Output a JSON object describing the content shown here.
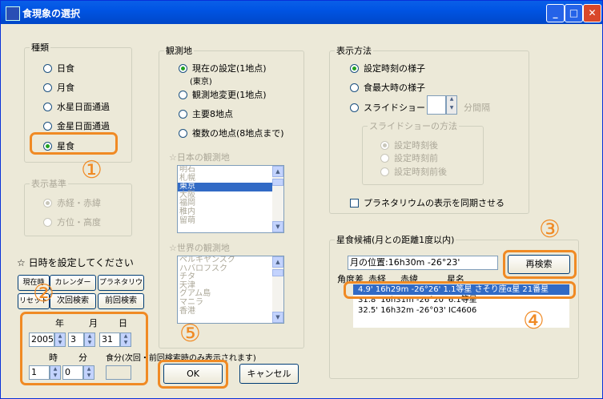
{
  "window": {
    "title": "食現象の選択"
  },
  "type_group": {
    "legend": "種類",
    "options": [
      "日食",
      "月食",
      "水星日面通過",
      "金星日面通過",
      "星食"
    ],
    "selected": "星食"
  },
  "reference_group": {
    "legend": "表示基準",
    "options": [
      "赤経・赤緯",
      "方位・高度"
    ]
  },
  "datetime": {
    "heading": "☆ 日時を設定してください",
    "buttons": [
      "現在時",
      "カレンダー",
      "プラネタリウム",
      "リセット",
      "次回検索",
      "前回検索"
    ],
    "labels": {
      "year": "年",
      "month": "月",
      "day": "日",
      "hour": "時",
      "minute": "分",
      "eclipse_min": "食分(次回・前回検索時のみ表示されます)"
    },
    "year": "2005",
    "month": "3",
    "day": "31",
    "hour": "1",
    "minute": "0",
    "eclipse_value": ""
  },
  "observation": {
    "legend": "観測地",
    "options": [
      "現在の設定(1地点)",
      "観測地変更(1地点)",
      "主要8地点",
      "複数の地点(8地点まで)"
    ],
    "current_sub": "(東京)",
    "japan_label": "☆日本の観測地",
    "japan_list": [
      "明石",
      "札幌",
      "東京",
      "大阪",
      "福岡",
      "稚内",
      "留萌"
    ],
    "japan_selected": "東京",
    "world_label": "☆世界の観測地",
    "world_list": [
      "ペルキヤンスク",
      "ハバロフスク",
      "チタ",
      "天津",
      "グアム島",
      "マニラ",
      "香港"
    ]
  },
  "display": {
    "legend": "表示方法",
    "options": [
      "設定時刻の様子",
      "食最大時の様子",
      "スライドショー"
    ],
    "interval_label": "分間隔",
    "slideshow_legend": "スライドショーの方法",
    "slideshow_options": [
      "設定時刻後",
      "設定時刻前",
      "設定時刻前後"
    ],
    "sync_label": "プラネタリウムの表示を同期させる"
  },
  "candidates": {
    "legend": "星食候補(月との距離1度以内)",
    "moon_position": "月の位置:16h30m -26°23'",
    "research_button": "再検索",
    "columns": [
      "角度差",
      "赤経",
      "赤緯",
      "星名"
    ],
    "rows": [
      "4.9' 16h29m -26°26' 1.1等星 さそり座α星 21番星",
      "31.8' 16h31m -26°20' 6.1等星",
      "32.5' 16h32m -26°03' IC4606"
    ],
    "selected_index": 0
  },
  "footer": {
    "ok": "OK",
    "cancel": "キャンセル"
  },
  "annotations": [
    "①",
    "②",
    "③",
    "④",
    "⑤"
  ],
  "colors": {
    "accent": "#f08a24",
    "selection": "#316ac5",
    "titlebar": "#0054e3"
  }
}
